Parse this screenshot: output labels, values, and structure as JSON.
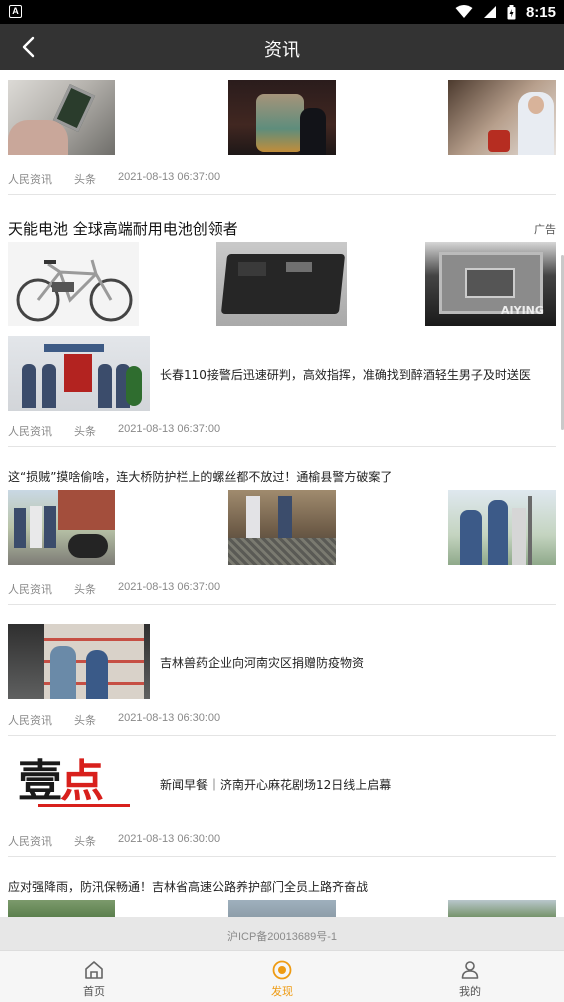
{
  "status_bar": {
    "time": "8:15",
    "notification_icon": "A"
  },
  "header": {
    "title": "资讯"
  },
  "articles": [
    {
      "source": "人民资讯",
      "tag": "头条",
      "time": "2021-08-13 06:37:00"
    },
    {
      "title": "长春110接警后迅速研判，高效指挥，准确找到醉酒轻生男子及时送医",
      "source": "人民资讯",
      "tag": "头条",
      "time": "2021-08-13 06:37:00"
    },
    {
      "title": "这“损贼”摸啥偷啥，连大桥防护栏上的螺丝都不放过！通榆县警方破案了",
      "source": "人民资讯",
      "tag": "头条",
      "time": "2021-08-13 06:37:00"
    },
    {
      "title": "吉林兽药企业向河南灾区捐赠防疫物资",
      "source": "人民资讯",
      "tag": "头条",
      "time": "2021-08-13 06:30:00"
    },
    {
      "title": "新闻早餐｜济南开心麻花剧场12日线上启幕",
      "source": "人民资讯",
      "tag": "头条",
      "time": "2021-08-13 06:30:00",
      "logo_text": "壹点"
    },
    {
      "title": "应对强降雨，防汛保畅通！吉林省高速公路养护部门全员上路齐奋战"
    }
  ],
  "ad": {
    "title": "天能电池 全球高端耐用电池创领者",
    "badge": "广告",
    "brand_text": "AIYING"
  },
  "footer": {
    "icp": "沪ICP备20013689号-1"
  },
  "tabs": [
    {
      "label": "首页",
      "icon": "home-icon",
      "active": false
    },
    {
      "label": "发现",
      "icon": "discover-icon",
      "active": true
    },
    {
      "label": "我的",
      "icon": "profile-icon",
      "active": false
    }
  ],
  "colors": {
    "accent": "#ee9b13",
    "header_bg": "#333333",
    "meta_text": "#888888"
  }
}
